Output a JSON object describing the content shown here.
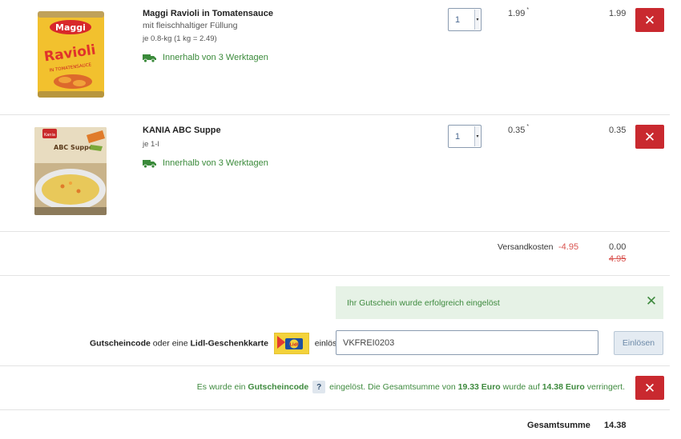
{
  "cart": {
    "items": [
      {
        "name": "Maggi Ravioli in Tomatensauce",
        "description": "mit fleischhaltiger Füllung",
        "base_price": "je 0.8-kg (1 kg = 2.49)",
        "delivery": "Innerhalb von 3 Werktagen",
        "quantity": "1",
        "unit_price": "1.99",
        "price_marker": "*",
        "total": "1.99",
        "image_brand": "Maggi",
        "image_title": "Ravioli",
        "image_sub": "IN TOMATENSAUCE"
      },
      {
        "name": "KANIA ABC Suppe",
        "description": "",
        "base_price": "je 1-l",
        "delivery": "Innerhalb von 3 Werktagen",
        "quantity": "1",
        "unit_price": "0.35",
        "price_marker": "*",
        "total": "0.35",
        "image_brand": "Kania",
        "image_title": "ABC Suppe"
      }
    ],
    "shipping": {
      "label": "Versandkosten",
      "discount": "-4.95",
      "value": "0.00",
      "original": "4.95"
    }
  },
  "coupon": {
    "success_message": "Ihr Gutschein wurde erfolgreich eingelöst",
    "label_bold": "Gutscheincode",
    "label_mid": " oder eine ",
    "label_bold2": "Lidl-Geschenkkarte",
    "label_end": "einlösen",
    "help": "?",
    "input_value": "VKFREI0203",
    "redeem_label": "Einlösen",
    "giftcard_text": "Lidl"
  },
  "applied": {
    "pre": "Es wurde ein ",
    "code_word": "Gutscheincode",
    "help": "?",
    "mid": " eingelöst. Die Gesamtsumme von ",
    "old_total": "19.33 Euro",
    "mid2": " wurde auf ",
    "new_total": "14.38 Euro",
    "post": " verringert."
  },
  "total": {
    "label": "Gesamtsumme",
    "value": "14.38"
  },
  "colors": {
    "delete_red": "#c9292f",
    "success_green": "#3e8a3e",
    "discount_red": "#d9534f"
  }
}
